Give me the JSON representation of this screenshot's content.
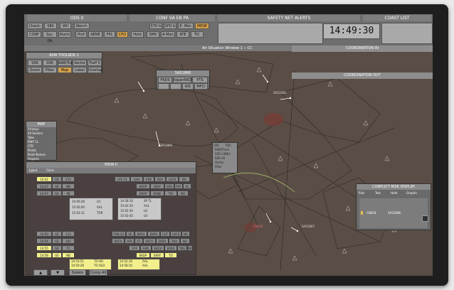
{
  "top": {
    "title_ods": "ODS II",
    "title_conf": "CONF  SA EB PA",
    "title_safety": "SAFETY NET ALERTS",
    "title_coast": "COAST LIST",
    "row1": [
      "Check-in",
      "SBII",
      "WII",
      "Watch-II",
      "STO b",
      "SFD b",
      "E- Mel-II",
      "MENE"
    ],
    "row2": [
      "CONF",
      "Sys. Ok",
      "Alarm",
      "Prof",
      "AENE",
      "FPL",
      "CPO",
      "Hold",
      "SMV",
      "A-Man",
      "ATE",
      "TIC"
    ],
    "clock": "14:49:30"
  },
  "situation": {
    "title": "Air Situation Window 1 -- CC",
    "coord_in": "COORDINATION IN",
    "coord_out": "COORDINATION OUT"
  },
  "toolbox": {
    "title": "ASW TOOLBOX 1",
    "row1": [
      "SSR Label",
      "SSR ALL",
      "RAB/Track",
      "Vector 5",
      "Traff 5"
    ],
    "row2": [
      "Zoom",
      "Filter",
      "Map",
      "Label",
      "Overlap"
    ]
  },
  "callwin": {
    "title": "SAS1866",
    "r1": [
      "FRDS 36",
      "topan6KCM",
      "PTS"
    ],
    "r2": [
      "Rmkl",
      "FEV",
      "RIS",
      "MFCI"
    ]
  },
  "maplayers": {
    "title": "MAP",
    "items": [
      "Airways",
      "All Sectors",
      "Tabs",
      "RWY CL",
      "CTR",
      "Points",
      "Point Names",
      "Airports"
    ]
  },
  "popup": {
    "items": [
      "HSI",
      "RID",
      "RAB/Track",
      "SSR LABEL",
      "SSR All",
      "Vector",
      "Filter"
    ]
  },
  "mdw": {
    "title": "MDW II",
    "menu": [
      "Lgout",
      "Coins"
    ],
    "footer": [
      "Delete",
      "Comp All"
    ],
    "row1": [
      "14:42",
      "GE",
      "115",
      "STE 41",
      "LHA",
      "EKB",
      "EKH",
      "LOCK",
      "NO"
    ],
    "row2": [
      "14:47",
      "GE",
      "NB",
      "EKOP",
      "EKRY",
      "SRB",
      "RAT",
      "AL"
    ],
    "row3": [
      "14:47",
      "GE",
      "MJ",
      "EKOP",
      "EKNE",
      "TIO",
      "NO"
    ],
    "block1": [
      "14:56:28",
      "LO",
      "15:02:00",
      "AAL",
      "15:02:11",
      "TOR"
    ],
    "block2": [
      "14:58:10",
      "SP TL",
      "15:02:20",
      "AAL",
      "15:02:30",
      "LO",
      "15:02:45",
      "LO"
    ],
    "row4": [
      "14:50",
      "GE",
      "111",
      "FKB 33",
      "SE",
      "EKCH",
      "EKRA",
      "CHT",
      "LOCK",
      "NO"
    ],
    "row5": [
      "14:54",
      "GE",
      "301",
      "EKCH",
      "ATB",
      "S7",
      "EKTO",
      "EKRA",
      "THR",
      "NO"
    ],
    "row6": [
      "14:55",
      "GE",
      "TC",
      "ST4",
      "EKB",
      "EKCH",
      "EKRA",
      "TNG",
      "NO"
    ],
    "row7": [
      "14:58",
      "GE",
      "NB",
      "EKOP",
      "EKRY",
      "TO"
    ],
    "block3": [
      "14:53:51",
      "TO HO",
      "14:50:28",
      "TO OLD",
      "14:58:01",
      "ALT"
    ],
    "block4": [
      "14:52:19",
      "AAL",
      "14:58:10",
      "AAL",
      "14:58:20",
      "AAL"
    ]
  },
  "conflict": {
    "title": "CONFLICT RISK DISPLAY",
    "options": [
      "Risk",
      "Test",
      "Hold",
      "Graphic"
    ],
    "pair": [
      "CNK28",
      "SAS1866"
    ]
  },
  "map_labels": [
    "SAS1866",
    "SAS1862",
    "CNK28",
    "SAS1867"
  ],
  "colors": {
    "screen": "#5a4d45",
    "map_line": "#2a2a2a",
    "track": "#ffffff",
    "accent": "#d5a24a",
    "highlight": "#f3ef8c"
  }
}
